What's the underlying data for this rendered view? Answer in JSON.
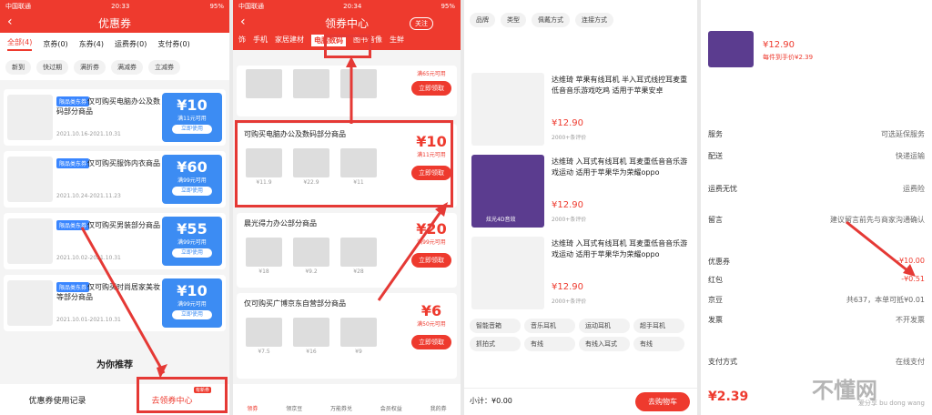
{
  "panel1": {
    "status": {
      "carrier": "中国联通",
      "time": "20:33",
      "battery": "95%"
    },
    "title": "优惠券",
    "tabs": [
      "全部(4)",
      "京券(0)",
      "东券(4)",
      "运费券(0)",
      "支付券(0)"
    ],
    "chips": [
      "新到",
      "快过期",
      "满折券",
      "满减券",
      "立减券"
    ],
    "cards": [
      {
        "tag": "限品类东券",
        "desc": "仅可购买电脑办公及数码部分商品",
        "date": "2021.10.16-2021.10.31",
        "amount": "¥10",
        "cond": "满11元可用",
        "btn": "立即使用"
      },
      {
        "tag": "限品类东券",
        "desc": "仅可购买服饰内衣商品",
        "date": "2021.10.24-2021.11.23",
        "amount": "¥60",
        "cond": "满99元可用",
        "btn": "立即使用"
      },
      {
        "tag": "限品类东券",
        "desc": "仅可购买男装部分商品",
        "date": "2021.10.02-2021.10.31",
        "amount": "¥55",
        "cond": "满99元可用",
        "btn": "立即使用"
      },
      {
        "tag": "限品类东券",
        "desc": "仅可购买时尚居家美妆等部分商品",
        "date": "2021.10.01-2021.10.31",
        "amount": "¥10",
        "cond": "满99元可用",
        "btn": "立即使用"
      }
    ],
    "recommend": "为你推荐",
    "bottom_left": "优惠券使用记录",
    "bottom_right": "去领券中心",
    "bottom_badge": "有新券"
  },
  "panel2": {
    "status": {
      "carrier": "中国联通",
      "time": "20:34",
      "battery": "95%"
    },
    "title": "领券中心",
    "follow": "关注",
    "cats": [
      "饰",
      "手机",
      "家居建材",
      "电脑数码",
      "图书音像",
      "生鲜"
    ],
    "cards": [
      {
        "title": "可购买电脑办公及数码部分商品",
        "amount": "¥10",
        "cond": "满11元可用",
        "btn": "立即领取",
        "prices": [
          "¥11.9",
          "¥22.9",
          "¥11"
        ]
      },
      {
        "title": "晨光得力办公部分商品",
        "amount": "¥20",
        "cond": "满99元可用",
        "btn": "立即领取",
        "prices": [
          "¥18",
          "¥9.2",
          "¥28"
        ]
      },
      {
        "title": "仅可购买广博京东自营部分商品",
        "amount": "¥6",
        "cond": "满50元可用",
        "btn": "立即领取",
        "prices": [
          "¥7.5",
          "¥16",
          "¥9"
        ]
      }
    ],
    "top_amount": "满65元可用",
    "top_btn": "立即领取",
    "nav": [
      "领券",
      "领京豆",
      "万能券兑",
      "会员权益",
      "我的券"
    ]
  },
  "panel3": {
    "filters": [
      "品牌",
      "类型",
      "佩戴方式",
      "连接方式"
    ],
    "items": [
      {
        "title": "达维琦 苹果有线耳机 半入耳式线控耳麦重低音音乐游戏吃鸡 适用于苹果安卓",
        "price": "¥12.90",
        "reviews": "2000+条评价"
      },
      {
        "title": "达维琦 入耳式有线耳机 耳麦重低音音乐游戏运动 适用于苹果华为荣耀oppo",
        "price": "¥12.90",
        "reviews": "2000+条评价"
      },
      {
        "title": "达维琦 入耳式有线耳机 耳麦重低音音乐游戏运动 适用于苹果华为荣耀oppo",
        "price": "¥12.90",
        "reviews": "2000+条评价"
      }
    ],
    "tags": [
      "智能音箱",
      "音乐耳机",
      "运动耳机",
      "超手耳机",
      "抓拍式",
      "有线",
      "有线入耳式",
      "有线"
    ],
    "total": "小计：¥0.00",
    "checkout": "去购物车",
    "badge": "炫光4D音效"
  },
  "panel4": {
    "price": "¥12.90",
    "price_note": "每件到手价¥2.39",
    "rows": [
      {
        "label": "服务",
        "value": "可选延保服务"
      },
      {
        "label": "配送",
        "value": "快递运输"
      },
      {
        "label": "运费无忧",
        "value": "运费险"
      },
      {
        "label": "留言",
        "value": "建议留言前先与商家沟通确认"
      },
      {
        "label": "优惠券",
        "value": "-¥10.00"
      },
      {
        "label": "红包",
        "value": "-¥0.51"
      },
      {
        "label": "京豆",
        "value": "共637，本单可抵¥0.01"
      },
      {
        "label": "发票",
        "value": "不开发票"
      },
      {
        "label": "支付方式",
        "value": "在线支付"
      }
    ],
    "total": "¥2.39",
    "watermark": "不懂网",
    "wm_small": "爱分享 bu dong wang"
  }
}
